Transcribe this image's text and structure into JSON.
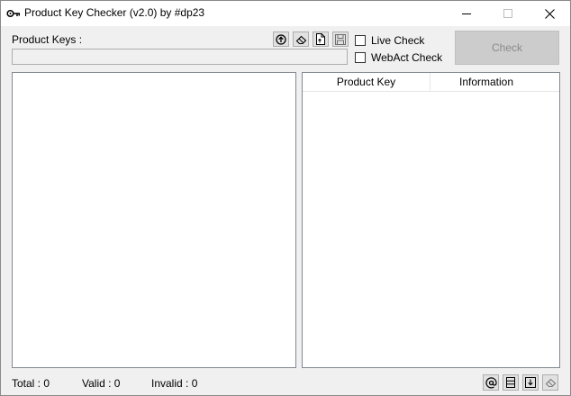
{
  "window": {
    "title": "Product Key Checker (v2.0) by #dp23"
  },
  "input": {
    "label": "Product Keys :",
    "value": ""
  },
  "options": {
    "live_check": "Live Check",
    "webact_check": "WebAct Check"
  },
  "check_button": "Check",
  "table": {
    "columns": [
      "Product Key",
      "Information"
    ],
    "rows": []
  },
  "status": {
    "total": "Total : 0",
    "valid": "Valid : 0",
    "invalid": "Invalid : 0"
  },
  "icons": {
    "top_toolbar": [
      "upload-icon",
      "eraser-icon",
      "open-file-icon",
      "save-icon"
    ],
    "bottom_toolbar": [
      "at-sign-icon",
      "list-icon",
      "export-icon",
      "eraser-icon"
    ]
  },
  "colors": {
    "check_button_disabled": "#cccccc",
    "disabled_text": "#8a8a8a"
  }
}
